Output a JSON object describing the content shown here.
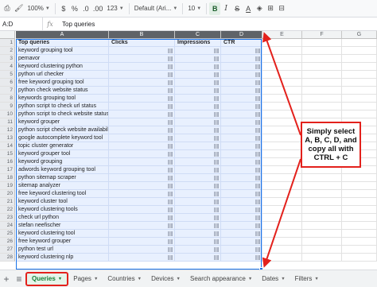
{
  "toolbar": {
    "zoom": "100%",
    "currency": "$",
    "percent": "%",
    "decrease_decimals": ".0",
    "increase_decimals": ".00",
    "number_format": "123",
    "font": "Default (Ari...",
    "font_size": "10",
    "bold": "B",
    "italic": "I",
    "strikethrough": "S",
    "text_color": "A"
  },
  "formula_bar": {
    "name_box": "A:D",
    "fx": "fx",
    "value": "Top queries"
  },
  "columns": [
    "A",
    "B",
    "C",
    "D",
    "E",
    "F",
    "G"
  ],
  "rows": [
    {
      "n": "1",
      "query": "Top queries",
      "clicks": "Clicks",
      "impressions": "Impressions",
      "ctr": "CTR"
    },
    {
      "n": "2",
      "query": "keyword grouping tool"
    },
    {
      "n": "3",
      "query": "pemavor"
    },
    {
      "n": "4",
      "query": "keyword clustering python"
    },
    {
      "n": "5",
      "query": "python url checker"
    },
    {
      "n": "6",
      "query": "free keyword grouping tool"
    },
    {
      "n": "7",
      "query": "python check website status"
    },
    {
      "n": "8",
      "query": "keywords grouping tool"
    },
    {
      "n": "9",
      "query": "python script to check url status"
    },
    {
      "n": "10",
      "query": "python script to check website status"
    },
    {
      "n": "11",
      "query": "keyword grouper"
    },
    {
      "n": "12",
      "query": "python script check website availability"
    },
    {
      "n": "13",
      "query": "google autocomplete keyword tool"
    },
    {
      "n": "14",
      "query": "topic cluster generator"
    },
    {
      "n": "15",
      "query": "keyword grouper tool"
    },
    {
      "n": "16",
      "query": "keyword grouping"
    },
    {
      "n": "17",
      "query": "adwords keyword grouping tool"
    },
    {
      "n": "18",
      "query": "python sitemap scraper"
    },
    {
      "n": "19",
      "query": "sitemap analyzer"
    },
    {
      "n": "20",
      "query": "free keyword clustering tool"
    },
    {
      "n": "21",
      "query": "keyword cluster tool"
    },
    {
      "n": "22",
      "query": "keyword clustering tools"
    },
    {
      "n": "23",
      "query": "check url python"
    },
    {
      "n": "24",
      "query": "stefan neefischer"
    },
    {
      "n": "25",
      "query": "keyword clustering tool"
    },
    {
      "n": "26",
      "query": "free keyword grouper"
    },
    {
      "n": "27",
      "query": "python test url"
    },
    {
      "n": "28",
      "query": "keyword clustering nlp"
    }
  ],
  "annotation": {
    "text": "Simply select A, B, C, D, and copy all with CTRL + C",
    "color": "#e3211c"
  },
  "tabs": [
    {
      "label": "Queries",
      "active": true
    },
    {
      "label": "Pages"
    },
    {
      "label": "Countries"
    },
    {
      "label": "Devices"
    },
    {
      "label": "Search appearance"
    },
    {
      "label": "Dates"
    },
    {
      "label": "Filters"
    }
  ]
}
